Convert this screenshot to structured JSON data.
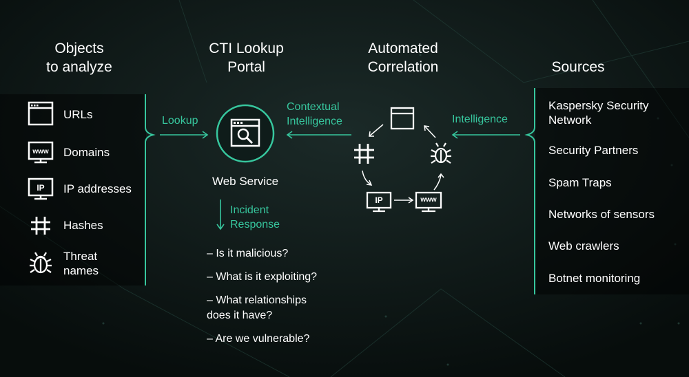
{
  "headers": {
    "objects": "Objects\nto analyze",
    "portal": "CTI Lookup\nPortal",
    "correlation": "Automated\nCorrelation",
    "sources": "Sources"
  },
  "objects": [
    {
      "label": "URLs",
      "icon": "browser-window-icon"
    },
    {
      "label": "Domains",
      "icon": "www-monitor-icon"
    },
    {
      "label": "IP addresses",
      "icon": "ip-monitor-icon"
    },
    {
      "label": "Hashes",
      "icon": "hash-icon"
    },
    {
      "label": "Threat\nnames",
      "icon": "bug-icon"
    }
  ],
  "arrows": {
    "lookup": "Lookup",
    "contextual": "Contextual\nIntelligence",
    "intelligence": "Intelligence",
    "incident": "Incident\nResponse"
  },
  "web_service": "Web Service",
  "questions": [
    "– Is it malicious?",
    "– What is it exploiting?",
    "– What relationships\ndoes it have?",
    "– Are we vulnerable?"
  ],
  "sources": [
    "Kaspersky Security\nNetwork",
    "Security Partners",
    "Spam Traps",
    "Networks of sensors",
    "Web crawlers",
    "Botnet monitoring"
  ],
  "icon_text": {
    "www": "www",
    "ip": "IP"
  },
  "colors": {
    "accent": "#37c79e",
    "background": "#0a1312",
    "text": "#ffffff"
  }
}
